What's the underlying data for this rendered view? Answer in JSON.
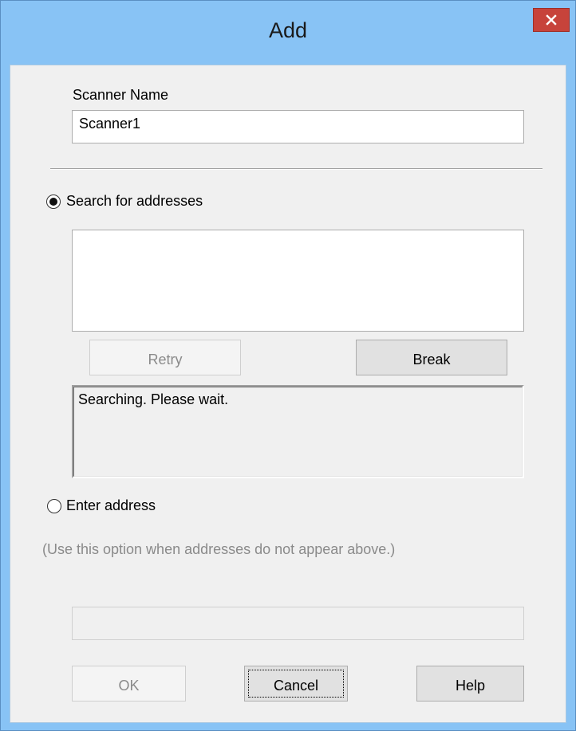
{
  "window": {
    "title": "Add"
  },
  "scanner_name": {
    "label": "Scanner Name",
    "value": "Scanner1"
  },
  "search_option": {
    "label": "Search for addresses",
    "selected": true
  },
  "search_results": [],
  "buttons": {
    "retry": "Retry",
    "break": "Break",
    "ok": "OK",
    "cancel": "Cancel",
    "help": "Help"
  },
  "status": {
    "message": "Searching. Please wait."
  },
  "enter_option": {
    "label": "Enter address",
    "selected": false,
    "hint": "(Use this option when addresses do not appear above.)",
    "address_value": ""
  },
  "icons": {
    "close": "close-icon",
    "radio_selected": "radio-selected-icon",
    "radio_unselected": "radio-unselected-icon"
  },
  "colors": {
    "title_bar": "#88c3f5",
    "close_button": "#c7433b",
    "dialog_background": "#f0f0f0",
    "disabled_text": "#8a8a8a"
  }
}
